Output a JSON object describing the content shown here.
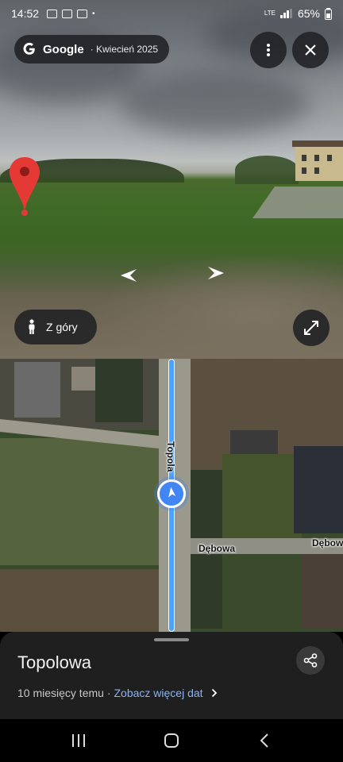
{
  "status_bar": {
    "time": "14:52",
    "network": "LTE",
    "battery": "65%"
  },
  "streetview": {
    "brand": "Google",
    "capture_date": "· Kwiecień 2025",
    "mode_button": "Z góry"
  },
  "map": {
    "street_main": "Topola",
    "street_cross_1": "Dębowa",
    "street_cross_2": "Dębow"
  },
  "sheet": {
    "title": "Topolowa",
    "age": "10 miesięcy temu ·",
    "more_dates": "Zobacz więcej dat"
  },
  "icons": {
    "menu": "more-vert-icon",
    "close": "close-icon",
    "expand": "expand-icon",
    "pegman": "pegman-icon",
    "share": "share-icon",
    "pin": "red-pin-icon"
  },
  "colors": {
    "accent_blue": "#4285f4",
    "link": "#8ab4f8",
    "route": "#4aa3ff"
  }
}
